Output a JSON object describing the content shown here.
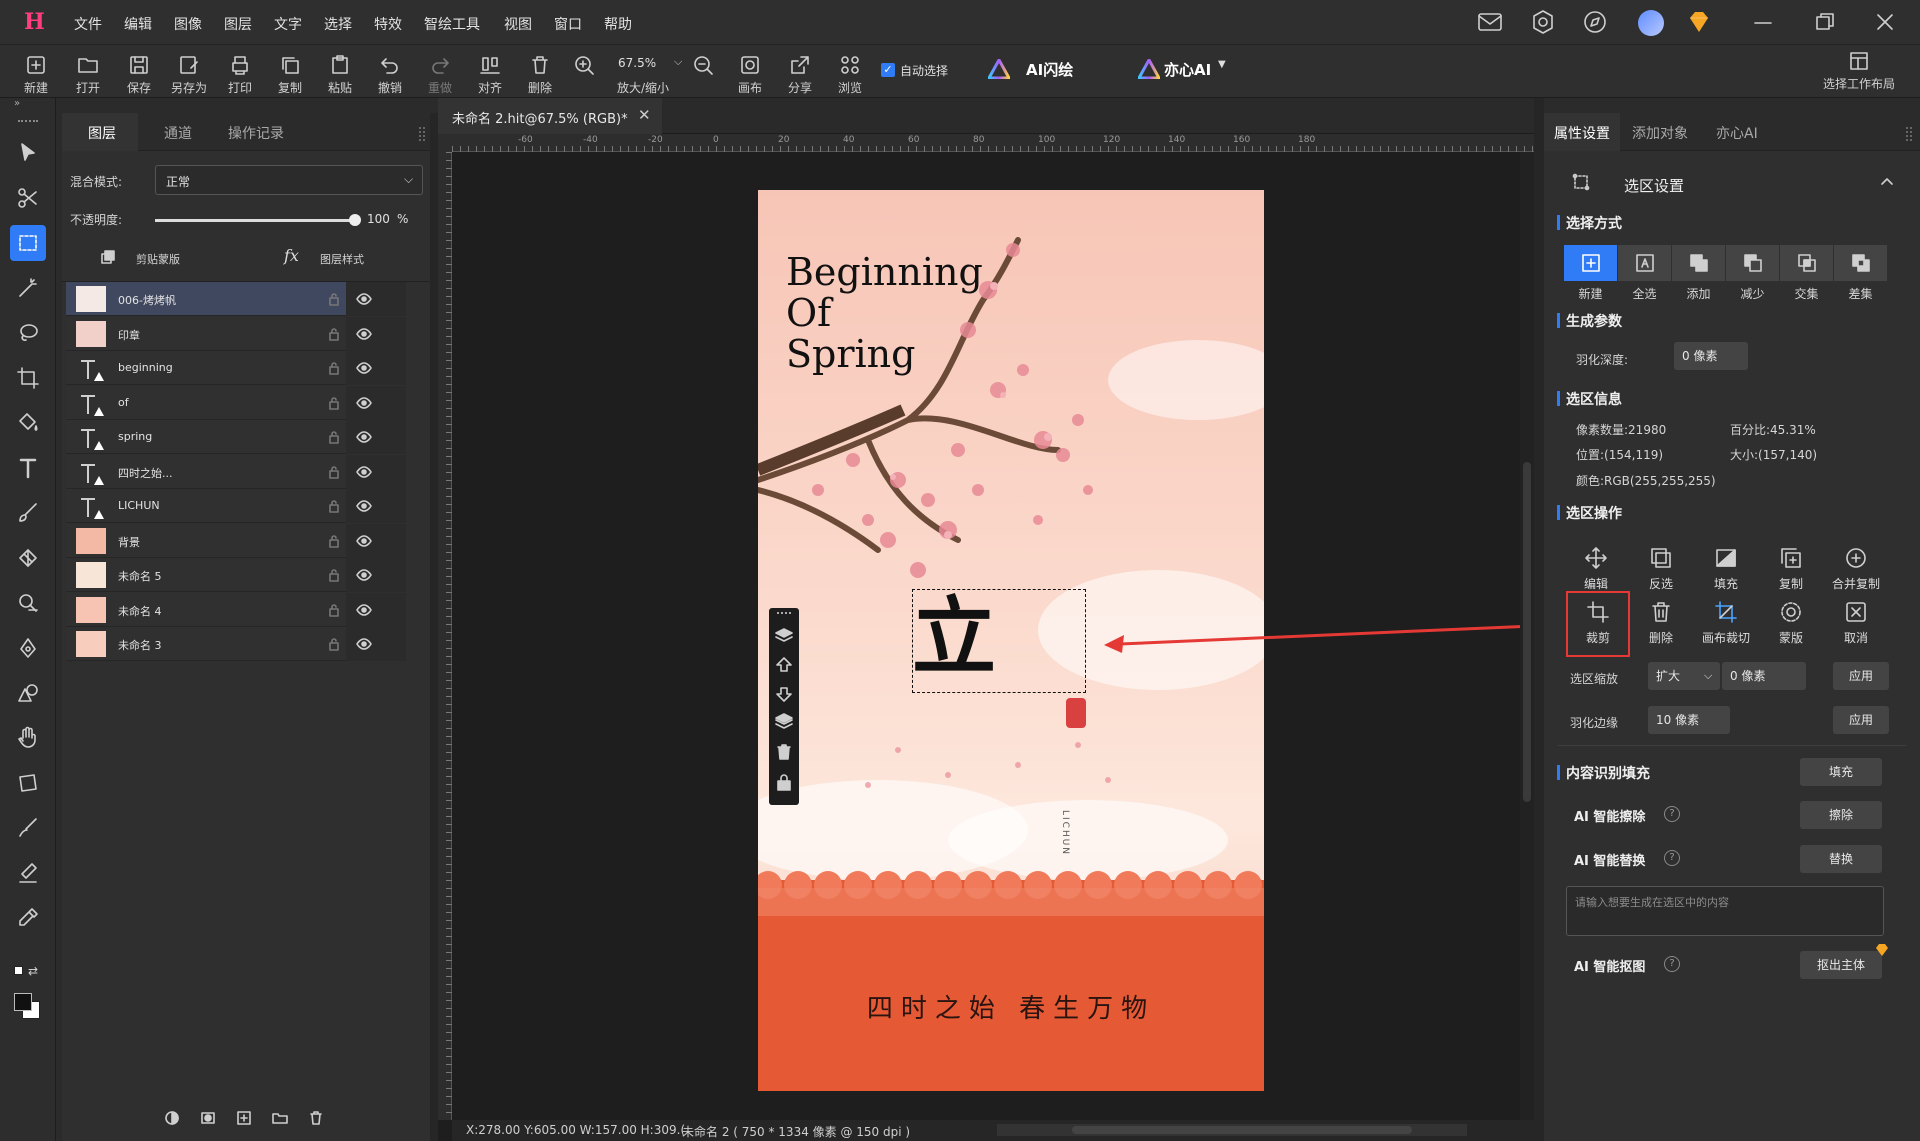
{
  "app": {
    "logo": "H"
  },
  "menu": [
    "文件",
    "编辑",
    "图像",
    "图层",
    "文字",
    "选择",
    "特效",
    "智绘工具",
    "视图",
    "窗口",
    "帮助"
  ],
  "toolbar": {
    "buttons": [
      "新建",
      "打开",
      "保存",
      "另存为",
      "打印",
      "复制",
      "粘贴",
      "撤销",
      "重做",
      "对齐",
      "删除"
    ],
    "zoom_value": "67.5%",
    "zoom_label": "放大/缩小",
    "canvas_label": "画布",
    "share_label": "分享",
    "browse_label": "浏览",
    "auto_select_label": "自动选择",
    "ai_flash_label": "AI闪绘",
    "yixin_label": "亦心AI",
    "workspace_label": "选择工作布局"
  },
  "layers_panel": {
    "tabs": [
      "图层",
      "通道",
      "操作记录"
    ],
    "blend_label": "混合模式:",
    "blend_value": "正常",
    "opacity_label": "不透明度:",
    "opacity_value": "100",
    "opacity_unit": "%",
    "opacity_fraction": 1.0,
    "clip_label": "剪贴蒙版",
    "fx_label": "fx",
    "style_label": "图层样式",
    "layers": [
      {
        "name": "006-烤烤帆",
        "type": "image",
        "selected": true
      },
      {
        "name": "印章",
        "type": "image",
        "selected": false
      },
      {
        "name": "beginning",
        "type": "text",
        "selected": false
      },
      {
        "name": "of",
        "type": "text",
        "selected": false
      },
      {
        "name": "spring",
        "type": "text",
        "selected": false
      },
      {
        "name": "四时之始...",
        "type": "text",
        "selected": false
      },
      {
        "name": "LICHUN",
        "type": "text",
        "selected": false
      },
      {
        "name": "背景",
        "type": "image",
        "selected": false
      },
      {
        "name": "未命名 5",
        "type": "image",
        "selected": false
      },
      {
        "name": "未命名 4",
        "type": "image",
        "selected": false
      },
      {
        "name": "未命名 3",
        "type": "image",
        "selected": false
      }
    ]
  },
  "document": {
    "tab_title": "未命名 2.hit@67.5% (RGB)*",
    "ruler_ticks": [
      "-60",
      "-40",
      "-20",
      "0",
      "20",
      "40",
      "60",
      "80",
      "100",
      "120",
      "140",
      "160",
      "180"
    ],
    "status_coords": "X:278.00 Y:605.00 W:157.00 H:309.(",
    "status_info": "未命名 2 ( 750 * 1334 像素 @ 150 dpi )",
    "poster": {
      "title_lines": [
        "Beginning",
        "Of",
        "Spring"
      ],
      "calligraphy": "立",
      "vertical_text": "LICHUN",
      "bottom_text": "四时之始 春生万物"
    }
  },
  "right_panel": {
    "tabs": [
      "属性设置",
      "添加对象",
      "亦心AI"
    ],
    "section_title": "选区设置",
    "select_mode_title": "选择方式",
    "select_modes": [
      "新建",
      "全选",
      "添加",
      "减少",
      "交集",
      "差集"
    ],
    "gen_params_title": "生成参数",
    "feather_label": "羽化深度:",
    "feather_value": "0 像素",
    "sel_info_title": "选区信息",
    "pixel_count": "像素数量:21980",
    "percent": "百分比:45.31%",
    "position": "位置:(154,119)",
    "size": "大小:(157,140)",
    "color": "颜色:RGB(255,255,255)",
    "sel_ops_title": "选区操作",
    "ops_row1": [
      "编辑",
      "反选",
      "填充",
      "复制",
      "合并复制"
    ],
    "ops_row2": [
      "裁剪",
      "删除",
      "画布裁切",
      "蒙版",
      "取消"
    ],
    "scale_label": "选区缩放",
    "scale_mode": "扩大",
    "scale_value": "0 像素",
    "apply_label": "应用",
    "feather_edge_label": "羽化边缘",
    "feather_edge_value": "10 像素",
    "content_fill_title": "内容识别填充",
    "fill_btn": "填充",
    "ai_erase_label": "AI 智能擦除",
    "erase_btn": "擦除",
    "ai_replace_label": "AI 智能替换",
    "replace_btn": "替换",
    "prompt_placeholder": "请输入想要生成在选区中的内容",
    "ai_cutout_label": "AI 智能抠图",
    "cutout_btn": "抠出主体"
  },
  "colors": {
    "accent": "#2f7cf6",
    "highlight": "#e53935",
    "poster_bottom": "#e55a35"
  }
}
